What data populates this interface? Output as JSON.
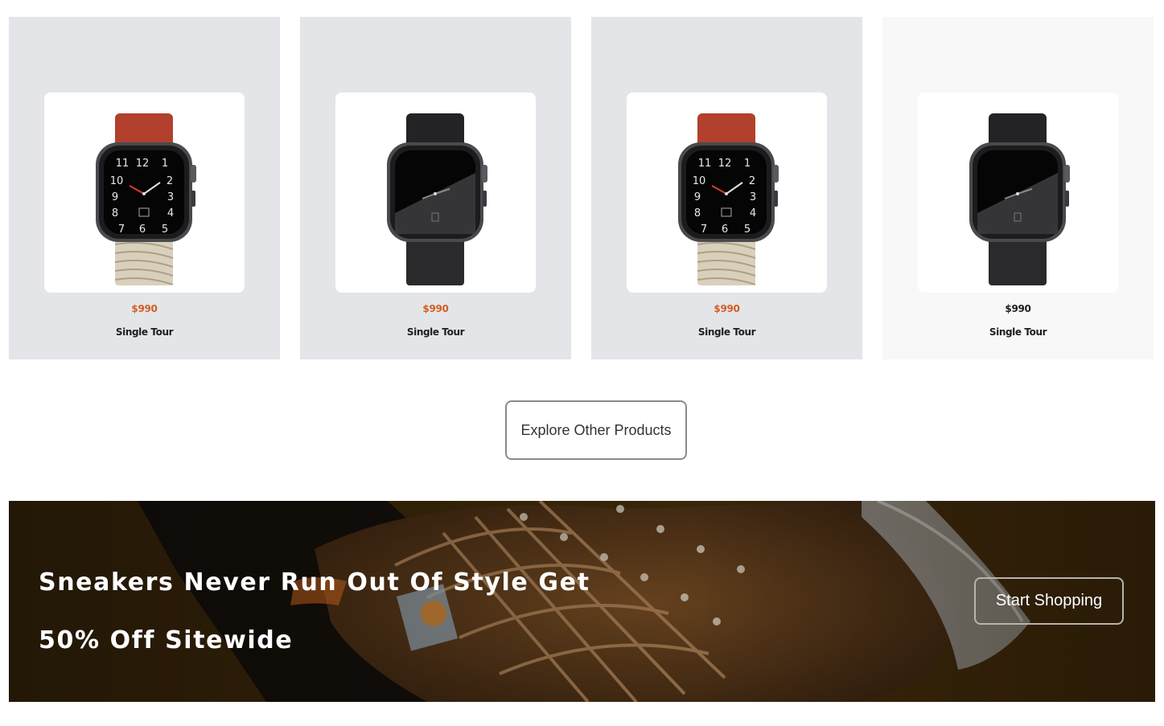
{
  "products": [
    {
      "price": "$990",
      "name": "Single Tour",
      "band": "red-canvas",
      "face": "numeric",
      "price_color": "#d35f22",
      "card": "grey"
    },
    {
      "price": "$990",
      "name": "Single Tour",
      "band": "black",
      "face": "plain",
      "price_color": "#d35f22",
      "card": "grey"
    },
    {
      "price": "$990",
      "name": "Single Tour",
      "band": "red-canvas",
      "face": "numeric",
      "price_color": "#d35f22",
      "card": "grey"
    },
    {
      "price": "$990",
      "name": "Single Tour",
      "band": "black",
      "face": "plain",
      "price_color": "#1e1e1e",
      "card": "light"
    }
  ],
  "explore_button": {
    "label": "Explore Other Products"
  },
  "banner": {
    "headline": "Sneakers Never Run Out Of Style Get 50% Off Sitewide",
    "cta_label": "Start Shopping",
    "image": "sneaker-background"
  },
  "colors": {
    "accent_price": "#d35f22",
    "card_grey": "#e4e5e9",
    "card_light": "#f8f8f8"
  }
}
